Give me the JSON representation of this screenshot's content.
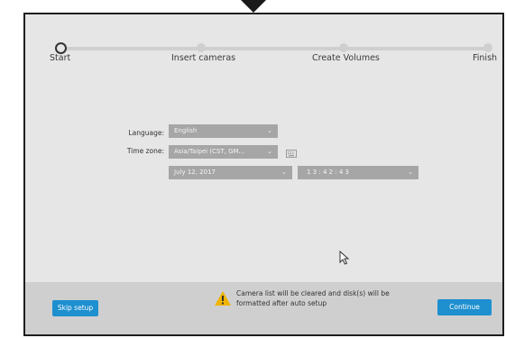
{
  "steps": [
    {
      "label": "Start",
      "active": true
    },
    {
      "label": "Insert cameras",
      "active": false
    },
    {
      "label": "Create Volumes",
      "active": false
    },
    {
      "label": "Finish",
      "active": false
    }
  ],
  "form": {
    "language_label": "Language:",
    "language_value": "English",
    "timezone_label": "Time zone:",
    "timezone_value": "Asia/Taipei (CST, GM...",
    "date_value": "July 12, 2017",
    "time_value": "1 3  : 4 2  : 4 3"
  },
  "footer": {
    "skip_label": "Skip setup",
    "warning_text": "Camera list will be cleared and disk(s) will be formatted after auto setup",
    "continue_label": "Continue"
  },
  "icons": {
    "keyboard": "keyboard-icon",
    "warning": "warning-icon",
    "cursor": "mouse-cursor-icon"
  },
  "colors": {
    "accent": "#1e8fcf",
    "warning": "#f0b400"
  }
}
